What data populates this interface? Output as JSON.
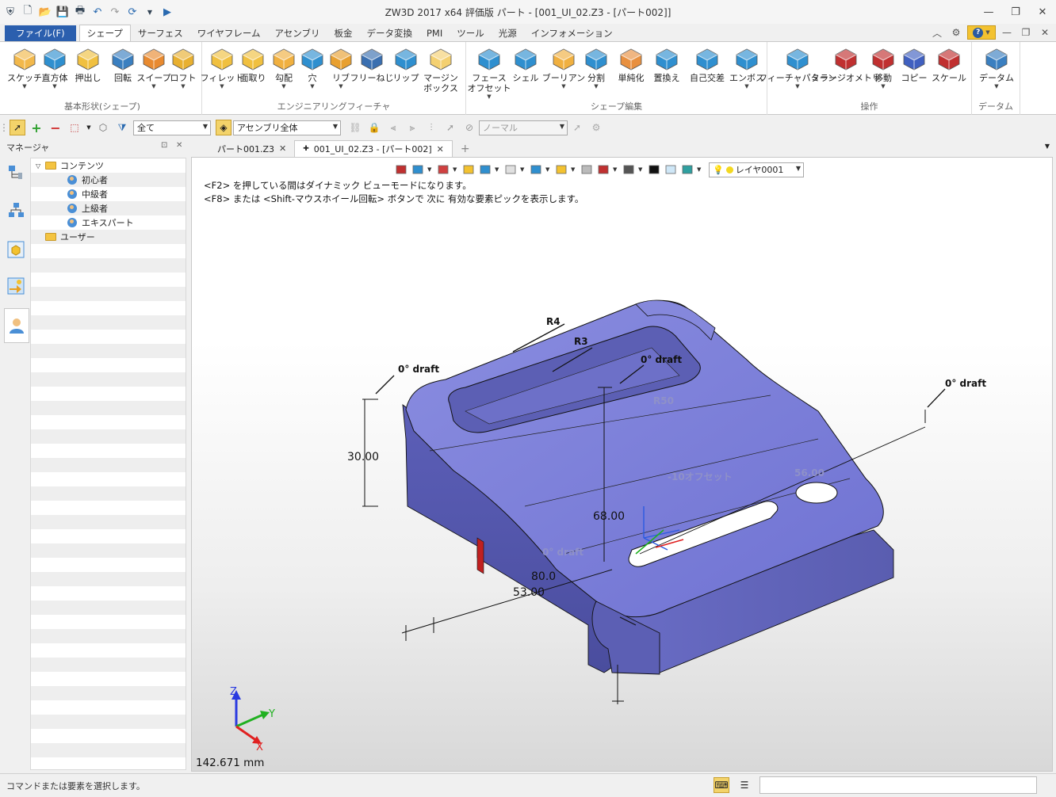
{
  "window": {
    "title": "ZW3D 2017  x64 評価版       パート - [001_UI_02.Z3 - [パート002]]",
    "controls": [
      "minimize-icon",
      "restore-icon",
      "close-icon"
    ]
  },
  "quick_access": [
    "app-logo-icon",
    "new-file-icon",
    "open-file-icon",
    "save-icon",
    "print-icon",
    "undo-icon",
    "redo-icon",
    "refresh-icon",
    "customize-icon",
    "run-icon"
  ],
  "ribbon_tabs": {
    "file": "ファイル(F)",
    "tabs": [
      "シェープ",
      "サーフェス",
      "ワイヤフレーム",
      "アセンブリ",
      "板金",
      "データ変換",
      "PMI",
      "ツール",
      "光源",
      "インフォメーション"
    ],
    "active": "シェープ"
  },
  "ribbon": {
    "groups": [
      {
        "label": "基本形状(シェープ)",
        "buttons": [
          {
            "label": "スケッチ",
            "icon": "sketch-icon",
            "color": "#f2b84b",
            "drop": true
          },
          {
            "label": "直方体",
            "icon": "box-icon",
            "color": "#2f8fcf",
            "drop": true
          },
          {
            "label": "押出し",
            "icon": "extrude-icon",
            "color": "#f0c040",
            "drop": false
          },
          {
            "label": "回転",
            "icon": "revolve-icon",
            "color": "#3a7fc0",
            "drop": false
          },
          {
            "label": "スイープ",
            "icon": "sweep-icon",
            "color": "#e88a30",
            "drop": true
          },
          {
            "label": "ロフト",
            "icon": "loft-icon",
            "color": "#e8b030",
            "drop": true
          }
        ]
      },
      {
        "label": "エンジニアリングフィーチャ",
        "buttons": [
          {
            "label": "フィレット",
            "icon": "fillet-icon",
            "color": "#f0c040",
            "drop": true
          },
          {
            "label": "面取り",
            "icon": "chamfer-icon",
            "color": "#f0c040",
            "drop": false
          },
          {
            "label": "勾配",
            "icon": "draft-icon",
            "color": "#f0b040",
            "drop": true
          },
          {
            "label": "穴",
            "icon": "hole-icon",
            "color": "#2f8fcf",
            "drop": true
          },
          {
            "label": "リブ",
            "icon": "rib-icon",
            "color": "#e8a030",
            "drop": true
          },
          {
            "label": "フリーねじ",
            "icon": "thread-icon",
            "color": "#3a6fb0",
            "drop": false
          },
          {
            "label": "リップ",
            "icon": "lip-icon",
            "color": "#2f8fcf",
            "drop": false
          },
          {
            "label": "マージン\nボックス",
            "icon": "margin-box-icon",
            "color": "#f4d070",
            "drop": false
          }
        ]
      },
      {
        "label": "シェープ編集",
        "buttons": [
          {
            "label": "フェース\nオフセット",
            "icon": "face-offset-icon",
            "color": "#2f8fcf",
            "drop": true
          },
          {
            "label": "シェル",
            "icon": "shell-icon",
            "color": "#2f8fcf",
            "drop": false
          },
          {
            "label": "ブーリアン",
            "icon": "boolean-icon",
            "color": "#f0b040",
            "drop": true
          },
          {
            "label": "分割",
            "icon": "split-icon",
            "color": "#2f8fcf",
            "drop": true
          },
          {
            "label": "単純化",
            "icon": "simplify-icon",
            "color": "#e89040",
            "drop": false
          },
          {
            "label": "置換え",
            "icon": "replace-icon",
            "color": "#2f8fcf",
            "drop": false
          },
          {
            "label": "自己交差",
            "icon": "self-intersect-icon",
            "color": "#2f8fcf",
            "drop": false
          },
          {
            "label": "エンボス",
            "icon": "emboss-icon",
            "color": "#2f8fcf",
            "drop": true
          }
        ]
      },
      {
        "label": "操作",
        "buttons": [
          {
            "label": "フィーチャパターン",
            "icon": "feature-pattern-icon",
            "color": "#2f8fcf",
            "drop": true
          },
          {
            "label": "ミラージオメトリ",
            "icon": "mirror-icon",
            "color": "#c03030",
            "drop": false
          },
          {
            "label": "移動",
            "icon": "move-icon",
            "color": "#c03030",
            "drop": true
          },
          {
            "label": "コピー",
            "icon": "copy-icon",
            "color": "#4060c0",
            "drop": false
          },
          {
            "label": "スケール",
            "icon": "scale-icon",
            "color": "#c03030",
            "drop": false
          }
        ]
      },
      {
        "label": "データム",
        "buttons": [
          {
            "label": "データム",
            "icon": "datum-icon",
            "color": "#3a7fc0",
            "drop": true
          }
        ]
      }
    ]
  },
  "toolbar2": {
    "filter_value": "全て",
    "scope_value": "アセンブリ全体",
    "mode_value": "ノーマル"
  },
  "manager": {
    "title": "マネージャ",
    "tree": [
      {
        "label": "コンテンツ",
        "type": "folder",
        "level": 0,
        "expanded": true
      },
      {
        "label": "初心者",
        "type": "user",
        "level": 1
      },
      {
        "label": "中級者",
        "type": "user",
        "level": 1
      },
      {
        "label": "上級者",
        "type": "user",
        "level": 1
      },
      {
        "label": "エキスパート",
        "type": "user",
        "level": 1
      },
      {
        "label": "ユーザー",
        "type": "folder",
        "level": 0
      }
    ],
    "side_icons": [
      "part-tree-icon",
      "hierarchy-icon",
      "component-icon",
      "image-arrow-icon",
      "user-profile-icon"
    ]
  },
  "doc_tabs": [
    {
      "label": "パート001.Z3",
      "active": false
    },
    {
      "label": "001_UI_02.Z3 - [パート002]",
      "active": true
    }
  ],
  "viewport": {
    "layer": "レイヤ0001",
    "hint1": "<F2> を押している間はダイナミック ビューモードになります。",
    "hint2": "<F8> または <Shift-マウスホイール回転> ボタンで 次に 有効な要素ピックを表示します。",
    "scale": "142.671 mm",
    "annotations": {
      "r4": "R4",
      "r3": "R3",
      "draft_left": "0° draft",
      "draft_mid": "0° draft",
      "draft_right": "0° draft",
      "dim_30": "30.00",
      "dim_68": "68.00",
      "dim_80": "80.0",
      "dim_53": "53.00",
      "r50": "R50",
      "offset": "-10オフセット",
      "dim_56": "56.00",
      "draft_inner": "0° draft"
    },
    "axis_labels": {
      "x": "X",
      "y": "Y",
      "z": "Z"
    },
    "model_color": "#6f72d2"
  },
  "status": {
    "text": "コマンドまたは要素を選択します。"
  }
}
